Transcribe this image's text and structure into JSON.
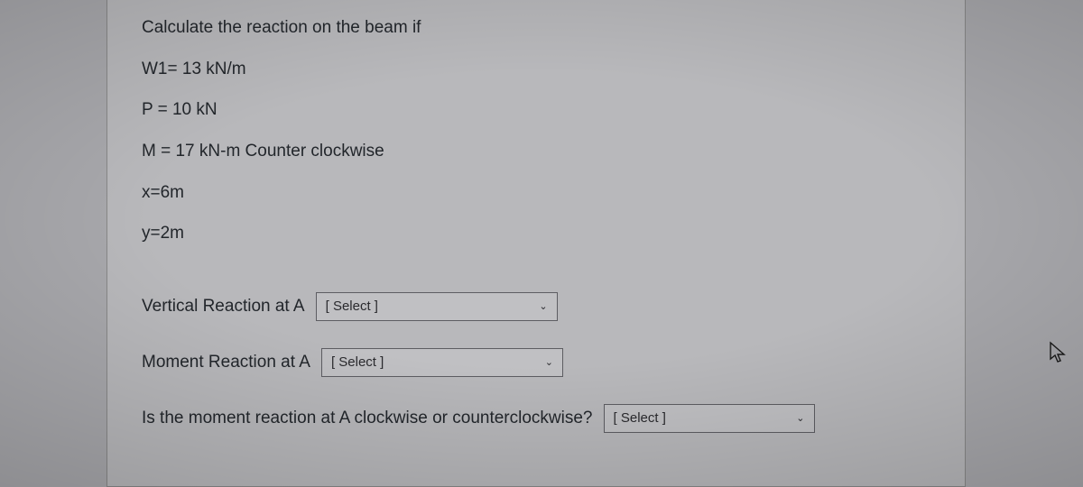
{
  "problem": {
    "intro": "Calculate the reaction on the beam if",
    "w1": "W1= 13 kN/m",
    "p": "P = 10 kN",
    "m": "M = 17 kN-m Counter clockwise",
    "x": "x=6m",
    "y": "y=2m"
  },
  "answers": {
    "vertical_label": "Vertical Reaction at A",
    "moment_label": "Moment Reaction at A",
    "direction_question": "Is the moment reaction at A clockwise or counterclockwise?",
    "select_placeholder": "[ Select ]"
  }
}
